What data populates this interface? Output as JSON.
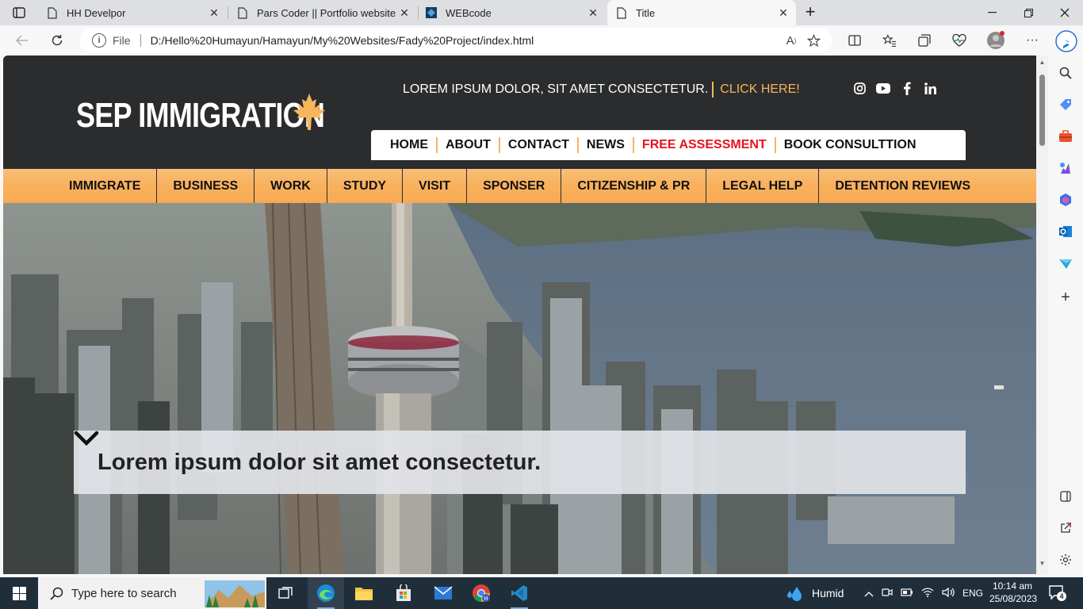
{
  "browser": {
    "tabs": [
      {
        "title": "HH Develpor",
        "active": false
      },
      {
        "title": "Pars Coder || Portfolio website",
        "active": false
      },
      {
        "title": "WEBcode",
        "active": false
      },
      {
        "title": "Title",
        "active": true
      }
    ],
    "address": {
      "scheme_label": "File",
      "url": "D:/Hello%20Humayun/Hamayun/My%20Websites/Fady%20Project/index.html"
    }
  },
  "site": {
    "logo": "SEP IMMIGRATION",
    "topline": {
      "text": "LOREM IPSUM DOLOR, SIT AMET CONSECTETUR.",
      "cta": "CLICK HERE!"
    },
    "socials": [
      "instagram-icon",
      "youtube-icon",
      "facebook-icon",
      "linkedin-icon"
    ],
    "main_nav": [
      {
        "label": "HOME",
        "highlight": false
      },
      {
        "label": "ABOUT",
        "highlight": false
      },
      {
        "label": "CONTACT",
        "highlight": false
      },
      {
        "label": "NEWS",
        "highlight": false
      },
      {
        "label": "FREE ASSESSMENT",
        "highlight": true
      },
      {
        "label": "BOOK CONSULTTION",
        "highlight": false
      }
    ],
    "sub_nav": [
      "IMMIGRATE",
      "BUSINESS",
      "WORK",
      "STUDY",
      "VISIT",
      "SPONSER",
      "CITIZENSHIP & PR",
      "LEGAL HELP",
      "DETENTION REVIEWS"
    ],
    "hero": {
      "title": "Lorem ipsum dolor sit amet consectetur."
    },
    "colors": {
      "header_bg": "#2b2c2e",
      "accent": "#f7b55e",
      "highlight": "#e8131b"
    }
  },
  "taskbar": {
    "search_placeholder": "Type here to search",
    "weather": "Humid",
    "language": "ENG",
    "time": "10:14 am",
    "date": "25/08/2023",
    "notification_count": "4"
  }
}
